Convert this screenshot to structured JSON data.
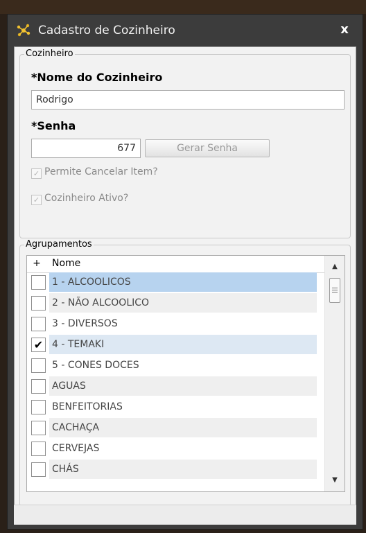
{
  "window": {
    "title": "Cadastro de Cozinheiro",
    "close_label": "x",
    "icon": "app-logo-icon"
  },
  "cozinheiro_group": {
    "legend": "Cozinheiro",
    "nome_label": "*Nome do Cozinheiro",
    "nome_value": "Rodrigo",
    "senha_label": "*Senha",
    "senha_value": "677",
    "gerar_senha_label": "Gerar Senha",
    "permite_cancelar_label": "Permite Cancelar Item?",
    "permite_cancelar_checked": true,
    "ativo_label": "Cozinheiro Ativo?",
    "ativo_checked": true
  },
  "agrupamentos_group": {
    "legend": "Agrupamentos",
    "header_plus": "+",
    "header_name": "Nome",
    "rows": [
      {
        "name": "1 - ALCOOLICOS",
        "checked": false
      },
      {
        "name": "2 - NÃO ALCOOLICO",
        "checked": false
      },
      {
        "name": "3 - DIVERSOS",
        "checked": false
      },
      {
        "name": "4 - TEMAKI",
        "checked": true
      },
      {
        "name": "5 - CONES DOCES",
        "checked": false
      },
      {
        "name": "AGUAS",
        "checked": false
      },
      {
        "name": "BENFEITORIAS",
        "checked": false
      },
      {
        "name": "CACHAÇA",
        "checked": false
      },
      {
        "name": "CERVEJAS",
        "checked": false
      },
      {
        "name": "CHÁS",
        "checked": false
      }
    ]
  },
  "colors": {
    "titlebar": "#3c3c3c",
    "selected_row": "#b7d3ef",
    "checked_row": "#dde8f3"
  }
}
